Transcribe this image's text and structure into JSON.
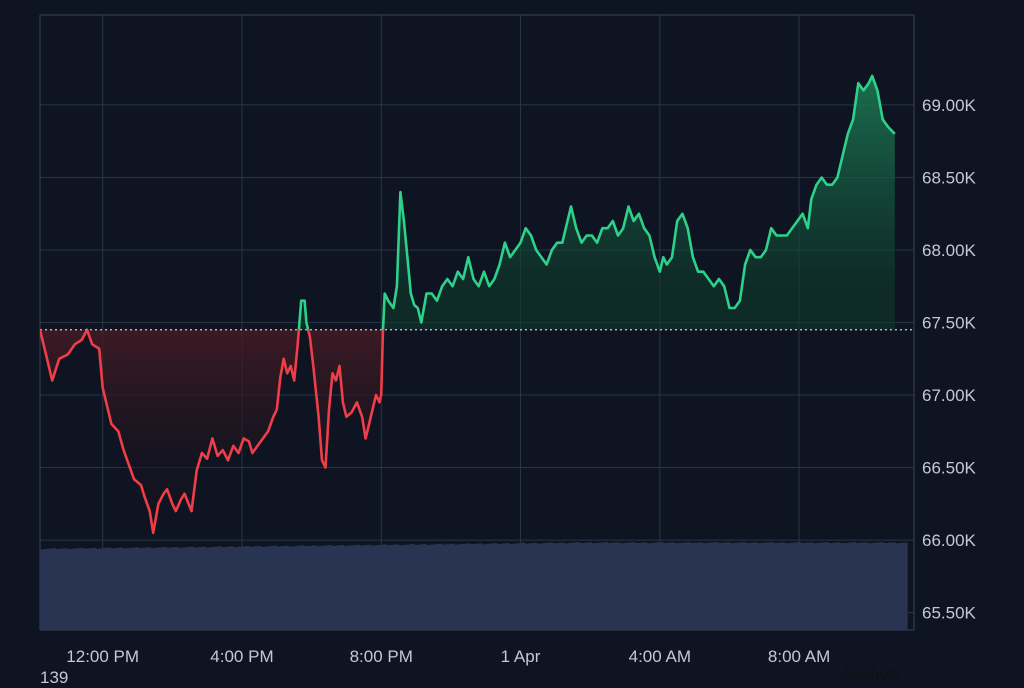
{
  "chart_data": {
    "type": "area",
    "baseline": 67450,
    "ylim": [
      65380,
      69620
    ],
    "y_ticks": [
      65500,
      66000,
      66500,
      67000,
      67500,
      68000,
      68500,
      69000
    ],
    "y_tick_labels": [
      "65.50K",
      "66.00K",
      "66.50K",
      "67.00K",
      "67.50K",
      "68.00K",
      "68.50K",
      "69.00K"
    ],
    "x_ticks": [
      12,
      16,
      20,
      24,
      28,
      32
    ],
    "x_tick_labels": [
      "12:00 PM",
      "4:00 PM",
      "8:00 PM",
      "1 Apr",
      "4:00 AM",
      "8:00 AM"
    ],
    "xlim": [
      10.2,
      35.3
    ],
    "series": [
      {
        "values": [
          [
            10.2,
            67450
          ],
          [
            10.4,
            67250
          ],
          [
            10.55,
            67100
          ],
          [
            10.75,
            67250
          ],
          [
            11.0,
            67280
          ],
          [
            11.2,
            67350
          ],
          [
            11.4,
            67380
          ],
          [
            11.55,
            67450
          ],
          [
            11.7,
            67350
          ],
          [
            11.9,
            67320
          ],
          [
            12.0,
            67050
          ],
          [
            12.1,
            66950
          ],
          [
            12.25,
            66800
          ],
          [
            12.45,
            66750
          ],
          [
            12.6,
            66620
          ],
          [
            12.75,
            66520
          ],
          [
            12.9,
            66420
          ],
          [
            13.1,
            66380
          ],
          [
            13.2,
            66300
          ],
          [
            13.35,
            66200
          ],
          [
            13.45,
            66050
          ],
          [
            13.6,
            66250
          ],
          [
            13.75,
            66320
          ],
          [
            13.85,
            66350
          ],
          [
            14.0,
            66250
          ],
          [
            14.1,
            66200
          ],
          [
            14.25,
            66280
          ],
          [
            14.35,
            66320
          ],
          [
            14.55,
            66200
          ],
          [
            14.7,
            66480
          ],
          [
            14.85,
            66600
          ],
          [
            15.0,
            66560
          ],
          [
            15.15,
            66700
          ],
          [
            15.3,
            66580
          ],
          [
            15.45,
            66620
          ],
          [
            15.6,
            66550
          ],
          [
            15.75,
            66650
          ],
          [
            15.9,
            66600
          ],
          [
            16.05,
            66700
          ],
          [
            16.2,
            66680
          ],
          [
            16.3,
            66600
          ],
          [
            16.45,
            66650
          ],
          [
            16.6,
            66700
          ],
          [
            16.75,
            66750
          ],
          [
            16.9,
            66850
          ],
          [
            17.0,
            66900
          ],
          [
            17.1,
            67120
          ],
          [
            17.2,
            67250
          ],
          [
            17.3,
            67150
          ],
          [
            17.4,
            67200
          ],
          [
            17.5,
            67100
          ],
          [
            17.6,
            67350
          ],
          [
            17.7,
            67650
          ],
          [
            17.8,
            67650
          ],
          [
            17.85,
            67500
          ],
          [
            17.95,
            67400
          ],
          [
            18.05,
            67200
          ],
          [
            18.2,
            66850
          ],
          [
            18.3,
            66550
          ],
          [
            18.4,
            66500
          ],
          [
            18.5,
            66900
          ],
          [
            18.6,
            67150
          ],
          [
            18.7,
            67100
          ],
          [
            18.8,
            67200
          ],
          [
            18.9,
            66950
          ],
          [
            19.0,
            66850
          ],
          [
            19.15,
            66880
          ],
          [
            19.3,
            66950
          ],
          [
            19.45,
            66850
          ],
          [
            19.55,
            66700
          ],
          [
            19.7,
            66850
          ],
          [
            19.85,
            67000
          ],
          [
            19.95,
            66950
          ],
          [
            20.0,
            67000
          ],
          [
            20.05,
            67450
          ],
          [
            20.1,
            67700
          ],
          [
            20.2,
            67650
          ],
          [
            20.35,
            67600
          ],
          [
            20.45,
            67750
          ],
          [
            20.55,
            68400
          ],
          [
            20.65,
            68200
          ],
          [
            20.75,
            67950
          ],
          [
            20.85,
            67700
          ],
          [
            20.95,
            67620
          ],
          [
            21.05,
            67600
          ],
          [
            21.15,
            67500
          ],
          [
            21.3,
            67700
          ],
          [
            21.45,
            67700
          ],
          [
            21.6,
            67650
          ],
          [
            21.75,
            67750
          ],
          [
            21.9,
            67800
          ],
          [
            22.05,
            67750
          ],
          [
            22.2,
            67850
          ],
          [
            22.35,
            67800
          ],
          [
            22.5,
            67950
          ],
          [
            22.65,
            67800
          ],
          [
            22.8,
            67750
          ],
          [
            22.95,
            67850
          ],
          [
            23.1,
            67750
          ],
          [
            23.25,
            67800
          ],
          [
            23.4,
            67900
          ],
          [
            23.55,
            68050
          ],
          [
            23.7,
            67950
          ],
          [
            23.85,
            68000
          ],
          [
            24.0,
            68050
          ],
          [
            24.15,
            68150
          ],
          [
            24.3,
            68100
          ],
          [
            24.45,
            68000
          ],
          [
            24.6,
            67950
          ],
          [
            24.75,
            67900
          ],
          [
            24.9,
            68000
          ],
          [
            25.05,
            68050
          ],
          [
            25.2,
            68050
          ],
          [
            25.35,
            68200
          ],
          [
            25.45,
            68300
          ],
          [
            25.6,
            68150
          ],
          [
            25.75,
            68050
          ],
          [
            25.9,
            68100
          ],
          [
            26.05,
            68100
          ],
          [
            26.2,
            68050
          ],
          [
            26.35,
            68150
          ],
          [
            26.5,
            68150
          ],
          [
            26.65,
            68200
          ],
          [
            26.8,
            68100
          ],
          [
            26.95,
            68150
          ],
          [
            27.1,
            68300
          ],
          [
            27.25,
            68200
          ],
          [
            27.4,
            68250
          ],
          [
            27.55,
            68150
          ],
          [
            27.7,
            68100
          ],
          [
            27.85,
            67950
          ],
          [
            28.0,
            67850
          ],
          [
            28.1,
            67950
          ],
          [
            28.2,
            67900
          ],
          [
            28.35,
            67950
          ],
          [
            28.5,
            68200
          ],
          [
            28.65,
            68250
          ],
          [
            28.8,
            68150
          ],
          [
            28.95,
            67950
          ],
          [
            29.1,
            67850
          ],
          [
            29.25,
            67850
          ],
          [
            29.4,
            67800
          ],
          [
            29.55,
            67750
          ],
          [
            29.7,
            67800
          ],
          [
            29.85,
            67750
          ],
          [
            30.0,
            67600
          ],
          [
            30.15,
            67600
          ],
          [
            30.3,
            67650
          ],
          [
            30.45,
            67900
          ],
          [
            30.6,
            68000
          ],
          [
            30.75,
            67950
          ],
          [
            30.9,
            67950
          ],
          [
            31.05,
            68000
          ],
          [
            31.2,
            68150
          ],
          [
            31.35,
            68100
          ],
          [
            31.5,
            68100
          ],
          [
            31.65,
            68100
          ],
          [
            31.8,
            68150
          ],
          [
            31.95,
            68200
          ],
          [
            32.1,
            68250
          ],
          [
            32.25,
            68150
          ],
          [
            32.35,
            68350
          ],
          [
            32.5,
            68450
          ],
          [
            32.65,
            68500
          ],
          [
            32.8,
            68450
          ],
          [
            32.95,
            68450
          ],
          [
            33.1,
            68500
          ],
          [
            33.25,
            68650
          ],
          [
            33.4,
            68800
          ],
          [
            33.55,
            68900
          ],
          [
            33.7,
            69150
          ],
          [
            33.85,
            69100
          ],
          [
            34.0,
            69150
          ],
          [
            34.1,
            69200
          ],
          [
            34.25,
            69100
          ],
          [
            34.4,
            68900
          ],
          [
            34.55,
            68850
          ],
          [
            34.75,
            68800
          ]
        ]
      }
    ],
    "volume": {
      "x_range": [
        10.2,
        35.1
      ],
      "levels": [
        0.92,
        0.99
      ]
    },
    "colors": {
      "up": "#2ed18a",
      "down": "#ef3e48",
      "volume": "#283452",
      "grid": "#2a3447",
      "baseline": "#c9ced6"
    }
  },
  "footer": {
    "left_text": "139",
    "right_text": "Analyze"
  }
}
